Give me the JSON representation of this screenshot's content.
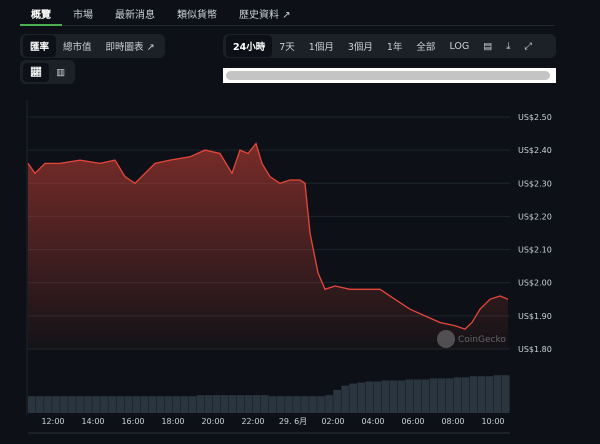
{
  "tabs": [
    {
      "label": "概覽"
    },
    {
      "label": "市場"
    },
    {
      "label": "最新消息"
    },
    {
      "label": "類似貨幣"
    },
    {
      "label": "歷史資料"
    }
  ],
  "chart_type_tabs": [
    {
      "label": "匯率"
    },
    {
      "label": "總市值"
    },
    {
      "label": "即時圖表"
    }
  ],
  "range_buttons": [
    {
      "label": "24小時"
    },
    {
      "label": "7天"
    },
    {
      "label": "1個月"
    },
    {
      "label": "3個月"
    },
    {
      "label": "1年"
    },
    {
      "label": "全部"
    },
    {
      "label": "LOG"
    }
  ],
  "watermark": "CoinGecko",
  "colors": {
    "line": "#e5473a",
    "accent": "#4caf50",
    "volume": "#2a3540"
  },
  "chart_data": {
    "type": "line",
    "title": "",
    "xlabel": "",
    "ylabel": "",
    "ylim": [
      1.8,
      2.5
    ],
    "yticks": [
      {
        "v": 2.5,
        "label": "US$2.50"
      },
      {
        "v": 2.4,
        "label": "US$2.40"
      },
      {
        "v": 2.3,
        "label": "US$2.30"
      },
      {
        "v": 2.2,
        "label": "US$2.20"
      },
      {
        "v": 2.1,
        "label": "US$2.10"
      },
      {
        "v": 2.0,
        "label": "US$2.00"
      },
      {
        "v": 1.9,
        "label": "US$1.90"
      },
      {
        "v": 1.8,
        "label": "US$1.80"
      }
    ],
    "xticks": [
      {
        "v": 12,
        "label": "12:00"
      },
      {
        "v": 14,
        "label": "14:00"
      },
      {
        "v": 16,
        "label": "16:00"
      },
      {
        "v": 18,
        "label": "18:00"
      },
      {
        "v": 20,
        "label": "20:00"
      },
      {
        "v": 22,
        "label": "22:00"
      },
      {
        "v": 24,
        "label": "29. 6月"
      },
      {
        "v": 26,
        "label": "02:00"
      },
      {
        "v": 28,
        "label": "04:00"
      },
      {
        "v": 30,
        "label": "06:00"
      },
      {
        "v": 32,
        "label": "08:00"
      },
      {
        "v": 34,
        "label": "10:00"
      }
    ],
    "xlim": [
      10.75,
      34.85
    ],
    "x": [
      10.75,
      11.1,
      11.6,
      12.35,
      13.35,
      14.35,
      15.1,
      15.6,
      16.1,
      16.6,
      17.1,
      17.85,
      18.85,
      19.6,
      20.35,
      20.95,
      21.35,
      21.75,
      22.15,
      22.45,
      22.85,
      23.35,
      23.85,
      24.35,
      24.6,
      24.85,
      25.25,
      25.6,
      26.1,
      26.85,
      27.6,
      28.35,
      29.1,
      29.85,
      30.6,
      31.35,
      32.1,
      32.6,
      32.95,
      33.35,
      33.85,
      34.35,
      34.75
    ],
    "values": [
      2.36,
      2.33,
      2.36,
      2.36,
      2.37,
      2.36,
      2.37,
      2.32,
      2.3,
      2.33,
      2.36,
      2.37,
      2.38,
      2.4,
      2.39,
      2.33,
      2.4,
      2.39,
      2.42,
      2.36,
      2.32,
      2.3,
      2.31,
      2.31,
      2.3,
      2.15,
      2.03,
      1.98,
      1.99,
      1.98,
      1.98,
      1.98,
      1.95,
      1.92,
      1.9,
      1.88,
      1.87,
      1.86,
      1.88,
      1.92,
      1.95,
      1.96,
      1.95
    ],
    "volume": [
      16,
      16,
      16,
      16,
      16,
      16,
      16,
      16,
      16,
      16,
      16,
      16,
      16,
      16,
      16,
      16,
      16,
      16,
      16,
      16,
      16,
      17,
      17,
      17,
      17,
      17,
      17,
      17,
      17,
      17,
      16,
      16,
      16,
      16,
      16,
      16,
      16,
      17,
      22,
      26,
      28,
      29,
      30,
      30,
      31,
      31,
      31,
      32,
      32,
      32,
      33,
      33,
      33,
      34,
      34,
      35,
      35,
      35,
      36,
      36
    ]
  }
}
